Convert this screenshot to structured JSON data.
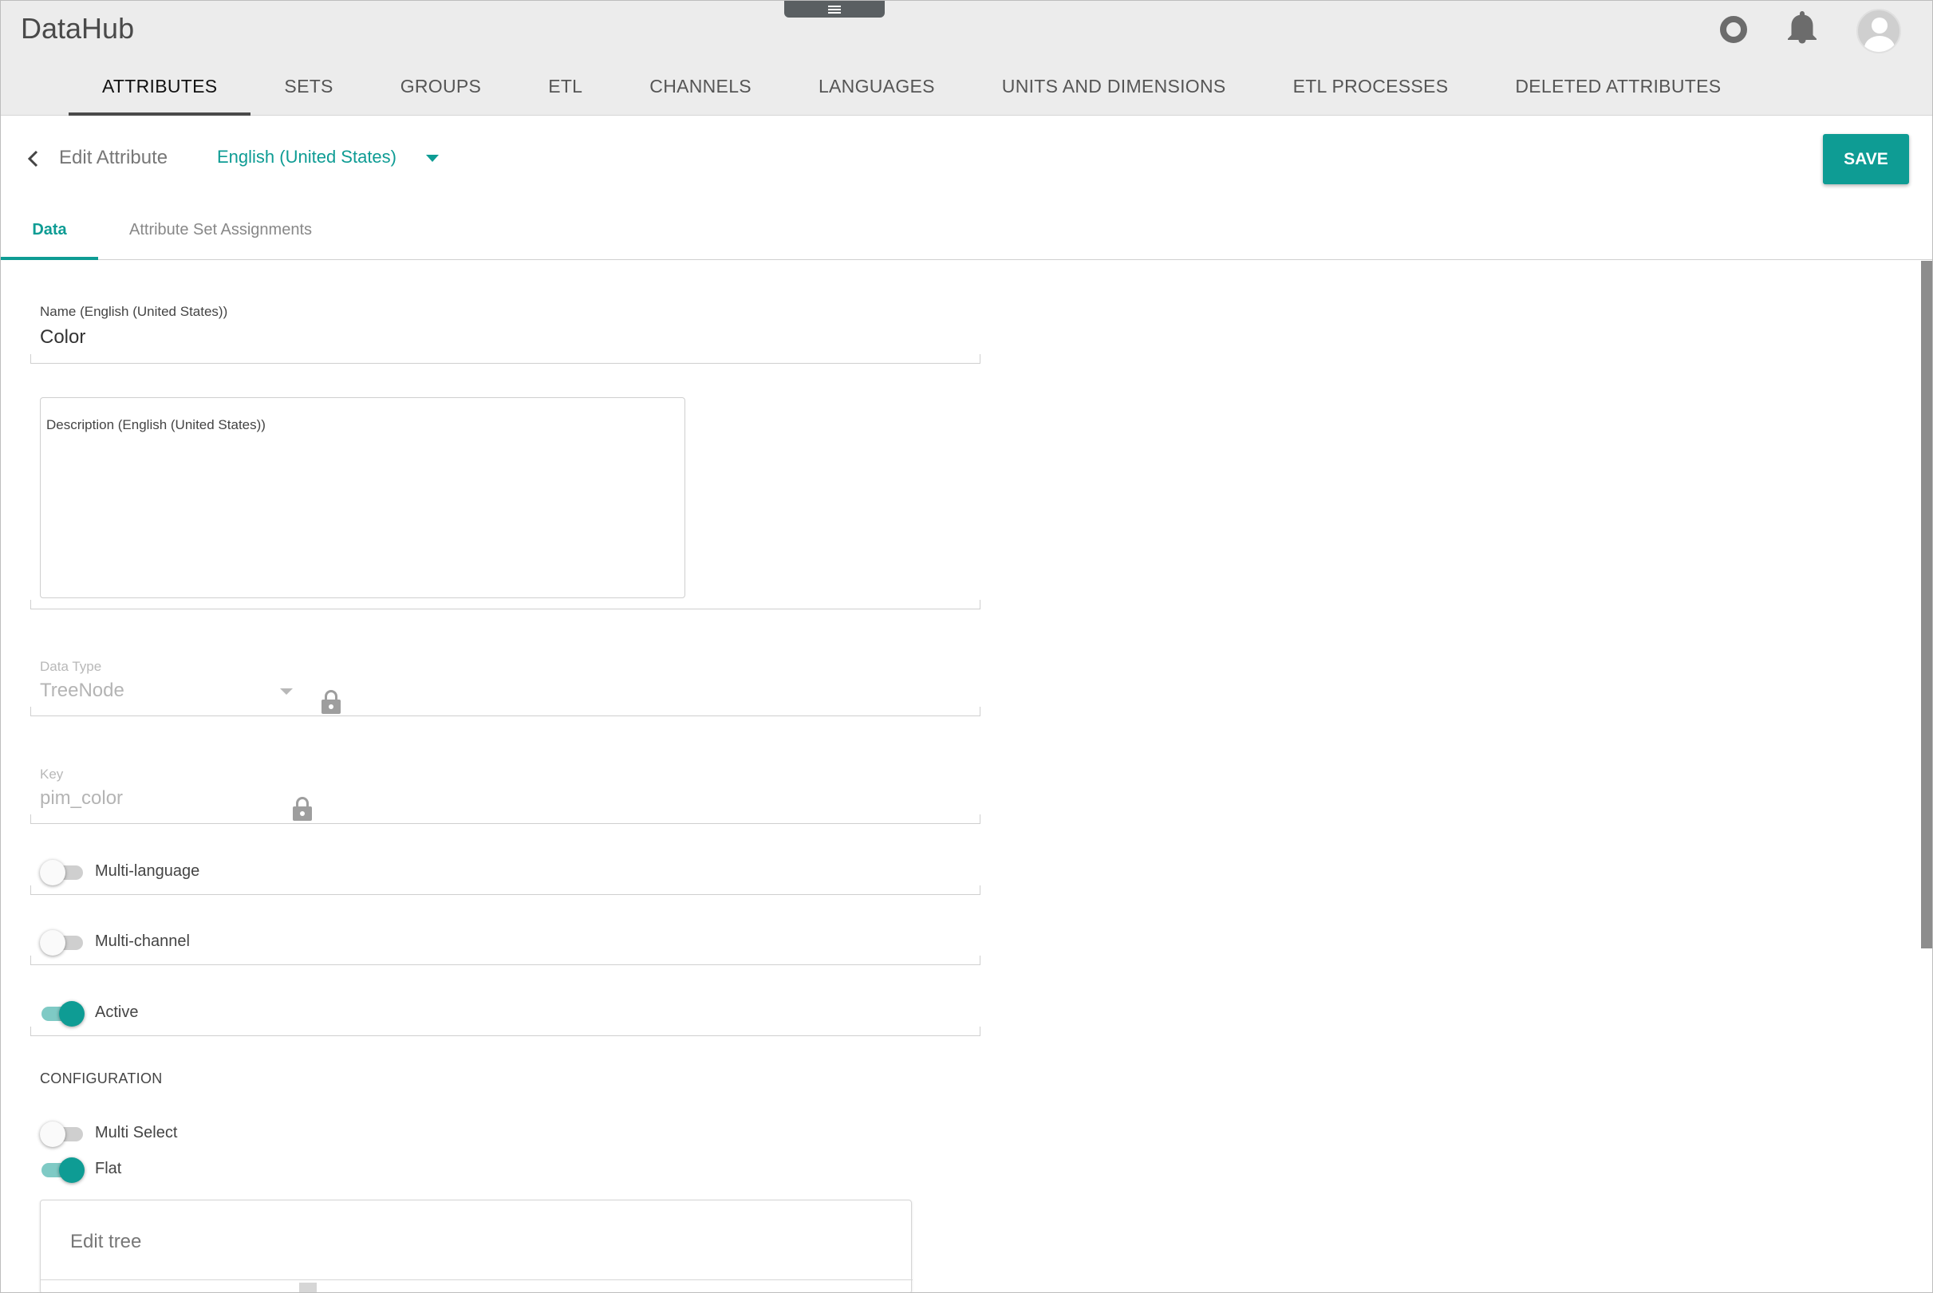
{
  "app": {
    "title": "DataHub"
  },
  "nav": {
    "tabs": [
      {
        "label": "ATTRIBUTES",
        "active": true
      },
      {
        "label": "SETS"
      },
      {
        "label": "GROUPS"
      },
      {
        "label": "ETL"
      },
      {
        "label": "CHANNELS"
      },
      {
        "label": "LANGUAGES"
      },
      {
        "label": "UNITS AND DIMENSIONS"
      },
      {
        "label": "ETL PROCESSES"
      },
      {
        "label": "DELETED ATTRIBUTES"
      }
    ]
  },
  "header_icons": [
    "status-ring-icon",
    "bell-icon",
    "user-avatar-icon"
  ],
  "page": {
    "title": "Edit Attribute",
    "language": "English (United States)",
    "save_label": "SAVE"
  },
  "tabs": {
    "data": "Data",
    "assignments": "Attribute Set Assignments"
  },
  "form": {
    "name": {
      "label": "Name (English (United States))",
      "value": "Color"
    },
    "description": {
      "label": "Description (English (United States))",
      "value": ""
    },
    "data_type": {
      "label": "Data Type",
      "value": "TreeNode"
    },
    "key": {
      "label": "Key",
      "value": "pim_color"
    },
    "multi_language": {
      "label": "Multi-language",
      "on": false
    },
    "multi_channel": {
      "label": "Multi-channel",
      "on": false
    },
    "active": {
      "label": "Active",
      "on": true
    }
  },
  "configuration": {
    "title": "CONFIGURATION",
    "multi_select": {
      "label": "Multi Select",
      "on": false
    },
    "flat": {
      "label": "Flat",
      "on": true
    },
    "edit_tree": "Edit tree"
  },
  "colors": {
    "accent": "#0e9c94",
    "header_bg": "#ececec"
  }
}
